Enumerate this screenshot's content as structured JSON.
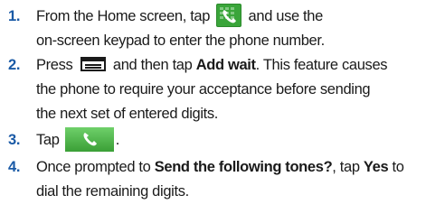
{
  "steps": [
    {
      "number": "1.",
      "t1": "From the Home screen, tap",
      "t2": "and use the",
      "t3": "on-screen keypad to enter the phone number.",
      "icon": "phone-dialer-icon"
    },
    {
      "number": "2.",
      "t1": "Press",
      "t2": "and then tap",
      "bold1": "Add wait",
      "t3": ". This feature causes",
      "t4": "the phone to require your acceptance before sending",
      "t5": "the next set of entered digits.",
      "icon": "menu-key-icon"
    },
    {
      "number": "3.",
      "t1": "Tap",
      "t2": ".",
      "icon": "call-button-icon"
    },
    {
      "number": "4.",
      "t1": "Once prompted to",
      "bold1": "Send the following tones?",
      "t2": ", tap",
      "bold2": "Yes",
      "t3": "to",
      "t4": "dial the remaining digits."
    }
  ],
  "colors": {
    "step_number": "#1a5aa6",
    "phone_icon_bg": "#3aa53a",
    "call_button_bg": "#4cb848"
  }
}
